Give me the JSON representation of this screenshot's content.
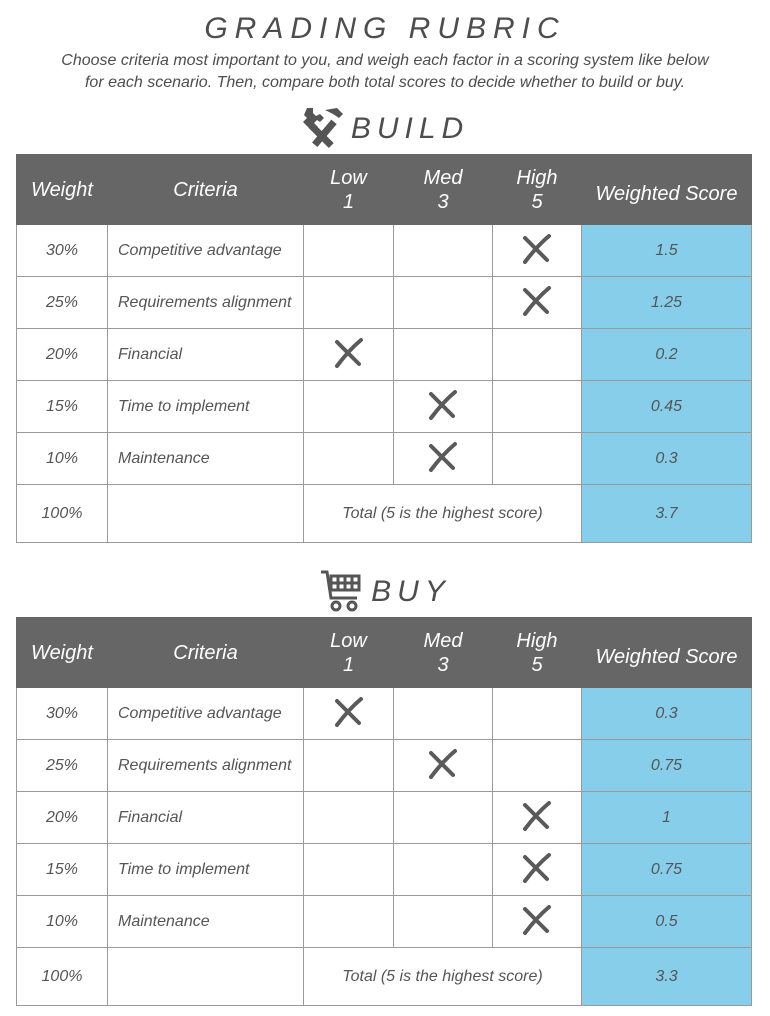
{
  "header": {
    "title": "GRADING RUBRIC",
    "subtitle_line1": "Choose criteria most important to you, and weigh each factor in a scoring system like below",
    "subtitle_line2": "for each scenario. Then, compare both total scores to decide whether to build or buy."
  },
  "columns": {
    "weight": "Weight",
    "criteria": "Criteria",
    "low": "Low",
    "low_value": "1",
    "med": "Med",
    "med_value": "3",
    "high": "High",
    "high_value": "5",
    "score": "Weighted Score"
  },
  "colors": {
    "header_bg": "#666666",
    "score_bg": "#87ceeb",
    "text": "#555555"
  },
  "build": {
    "label": "BUILD",
    "icon": "tools-icon",
    "rows": [
      {
        "weight": "30%",
        "criteria": "Competitive advantage",
        "rating": "high",
        "score": "1.5"
      },
      {
        "weight": "25%",
        "criteria": "Requirements alignment",
        "rating": "high",
        "score": "1.25"
      },
      {
        "weight": "20%",
        "criteria": "Financial",
        "rating": "low",
        "score": "0.2"
      },
      {
        "weight": "15%",
        "criteria": "Time to implement",
        "rating": "med",
        "score": "0.45"
      },
      {
        "weight": "10%",
        "criteria": "Maintenance",
        "rating": "med",
        "score": "0.3"
      }
    ],
    "total_weight": "100%",
    "total_label": "Total (5 is the highest score)",
    "total_score": "3.7"
  },
  "buy": {
    "label": "BUY",
    "icon": "shopping-cart-icon",
    "rows": [
      {
        "weight": "30%",
        "criteria": "Competitive advantage",
        "rating": "low",
        "score": "0.3"
      },
      {
        "weight": "25%",
        "criteria": "Requirements alignment",
        "rating": "med",
        "score": "0.75"
      },
      {
        "weight": "20%",
        "criteria": "Financial",
        "rating": "high",
        "score": "1"
      },
      {
        "weight": "15%",
        "criteria": "Time to implement",
        "rating": "high",
        "score": "0.75"
      },
      {
        "weight": "10%",
        "criteria": "Maintenance",
        "rating": "high",
        "score": "0.5"
      }
    ],
    "total_weight": "100%",
    "total_label": "Total (5 is the highest score)",
    "total_score": "3.3"
  }
}
